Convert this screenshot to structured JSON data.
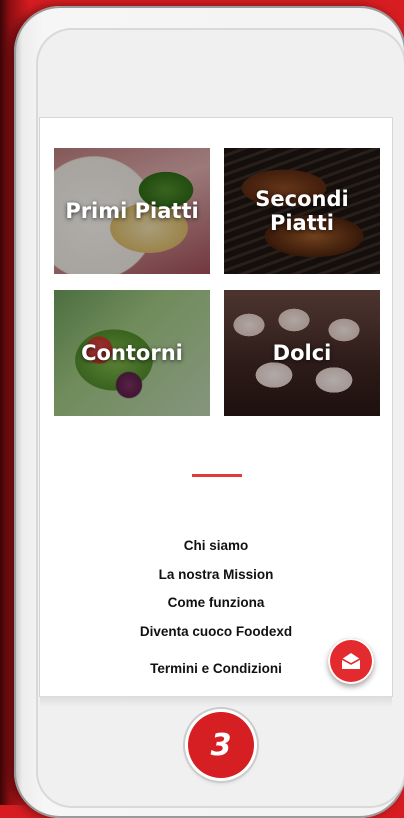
{
  "categories": [
    {
      "label": "Primi Piatti"
    },
    {
      "label": "Secondi\nPiatti"
    },
    {
      "label": "Contorni"
    },
    {
      "label": "Dolci"
    }
  ],
  "footer_links": [
    "Chi siamo",
    "La nostra Mission",
    "Come funziona",
    "Diventa cuoco Foodexd",
    "Termini e Condizioni"
  ],
  "fab": {
    "icon": "mail-open-icon"
  },
  "step_badge": "3",
  "colors": {
    "accent": "#e32a2e",
    "background": "#d81d22"
  }
}
